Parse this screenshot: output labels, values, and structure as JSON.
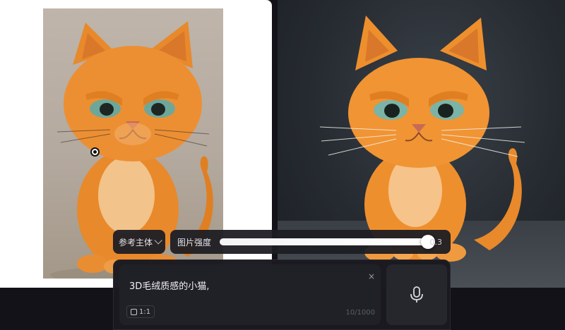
{
  "toolbar": {
    "subject_label": "参考主体",
    "strength_label": "图片强度",
    "strength_value_text": "0.3",
    "strength_fraction": 0.97
  },
  "prompt": {
    "text": "3D毛绒质感的小猫,",
    "clear_symbol": "×",
    "ratio_label": "1:1",
    "char_count": "10/1000"
  },
  "icons": {
    "subject_dropdown": "chevron-down-icon",
    "ratio": "square-ratio-icon",
    "mic": "microphone-icon",
    "cursor": "cursor-target-icon"
  },
  "colors": {
    "cat_fur": "#e8892b",
    "cat_chest": "#f2c38a",
    "eye": "#6ea79a",
    "ref_bg": "#bfb5aa",
    "result_bg": "#262b31"
  }
}
